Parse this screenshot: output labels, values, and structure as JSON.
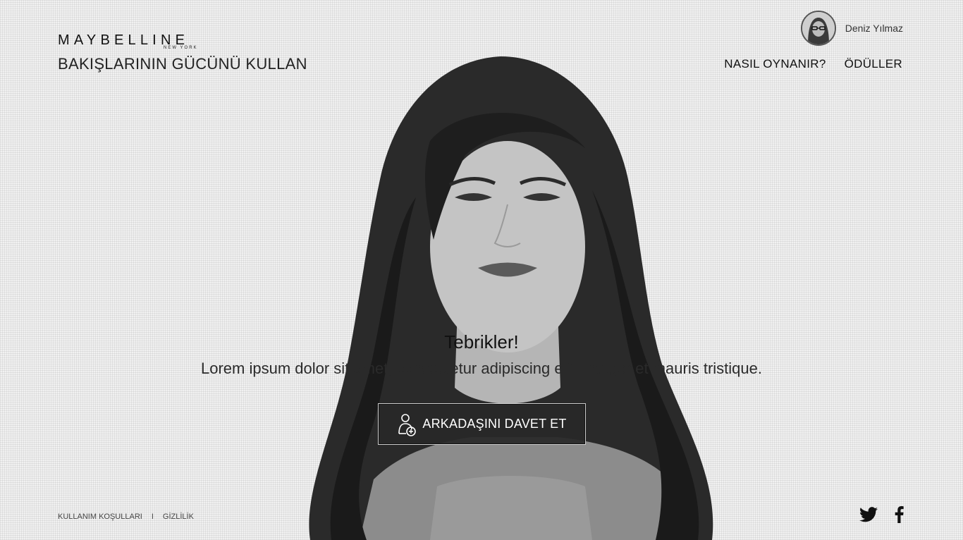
{
  "brand": {
    "logo": "MAYBELLINE",
    "logo_sub": "NEW YORK",
    "tagline": "BAKIŞLARININ GÜCÜNÜ KULLAN"
  },
  "user": {
    "name": "Deniz Yılmaz",
    "avatar_icon": "user-avatar"
  },
  "nav": {
    "how_to_play": "NASIL OYNANIR?",
    "rewards": "ÖDÜLLER"
  },
  "hero": {
    "title": "Tebrikler!",
    "text": "Lorem ipsum dolor sit amet, consectetur adipiscing elit. Integer et mauris tristique.",
    "button_label": "ARKADAŞINI DAVET ET",
    "button_icon": "add-user-icon"
  },
  "footer": {
    "terms": "KULLANIM KOŞULLARI",
    "separator": "I",
    "privacy": "GİZLİLİK"
  },
  "social": {
    "twitter_icon": "twitter-icon",
    "facebook_icon": "facebook-icon"
  }
}
